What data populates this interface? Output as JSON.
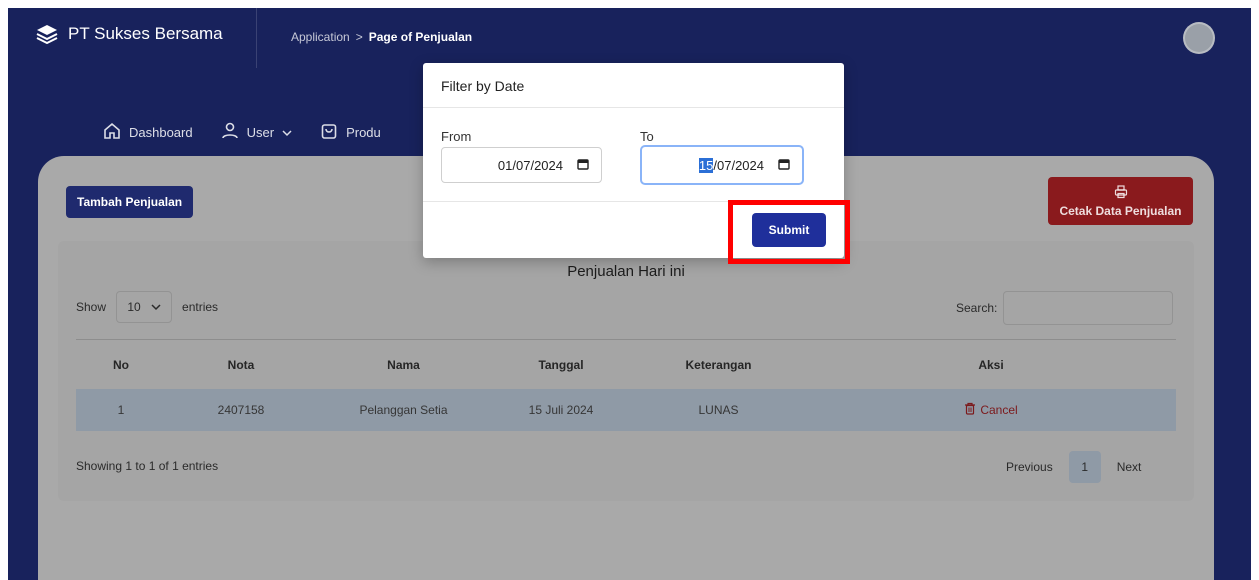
{
  "header": {
    "brand": "PT Sukses Bersama",
    "breadcrumb": {
      "parent": "Application",
      "separator": ">",
      "current": "Page of Penjualan"
    }
  },
  "nav": {
    "items": [
      {
        "label": "Dashboard",
        "icon": "home-icon"
      },
      {
        "label": "User",
        "icon": "user-icon",
        "dropdown": true
      },
      {
        "label": "Produ",
        "icon": "bag-icon"
      }
    ]
  },
  "toolbar": {
    "add_label": "Tambah Penjualan",
    "print_label": "Cetak Data Penjualan"
  },
  "table": {
    "title": "Penjualan Hari ini",
    "show_label": "Show",
    "entries_value": "10",
    "entries_label": "entries",
    "search_label": "Search:",
    "columns": [
      "No",
      "Nota",
      "Nama",
      "Tanggal",
      "Keterangan",
      "Aksi"
    ],
    "rows": [
      {
        "no": "1",
        "nota": "2407158",
        "nama": "Pelanggan Setia",
        "tanggal": "15 Juli 2024",
        "keterangan": "LUNAS",
        "aksi": "Cancel"
      }
    ],
    "info": "Showing 1 to 1 of 1 entries",
    "pager": {
      "prev": "Previous",
      "page": "1",
      "next": "Next"
    }
  },
  "modal": {
    "title": "Filter by Date",
    "from_label": "From",
    "from_value": "01/07/2024",
    "to_label": "To",
    "to_day_selected": "15",
    "to_rest": "/07/2024",
    "submit_label": "Submit"
  },
  "colors": {
    "header_bg": "#18225c",
    "highlight": "#ff0000",
    "submit_bg": "#1f2f9b",
    "cancel": "#7c1a1c"
  }
}
